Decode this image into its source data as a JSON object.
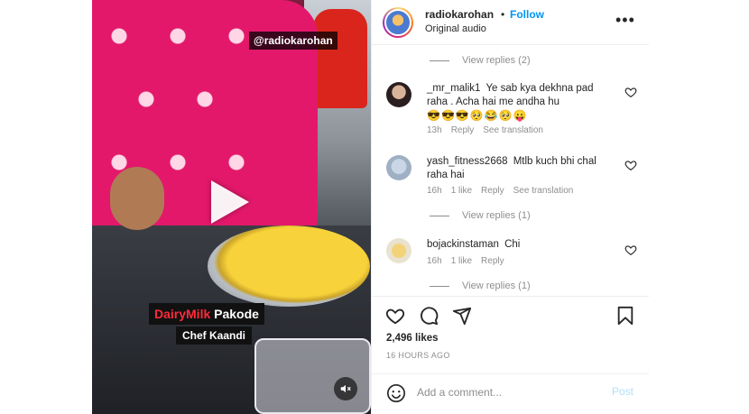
{
  "video": {
    "handle_overlay": "@radiokarohan",
    "title_red": "DairyMilk",
    "title_white": "Pakode",
    "subtitle": "Chef Kaandi"
  },
  "header": {
    "username": "radiokarohan",
    "separator": "•",
    "follow_label": "Follow",
    "audio": "Original audio",
    "more_icon": "more-horizontal-icon"
  },
  "comments": {
    "replies_top": "View replies (2)",
    "items": [
      {
        "username": "_mr_malik1",
        "text": "Ye sab kya dekhna pad raha . Acha hai me andha hu",
        "emojis": "😎😎😎🥺😂🥺😛",
        "time": "13h",
        "likes": "",
        "reply": "Reply",
        "translate": "See translation",
        "replies": ""
      },
      {
        "username": "yash_fitness2668",
        "text": "Mtlb kuch bhi chal raha hai",
        "emojis": "",
        "time": "16h",
        "likes": "1 like",
        "reply": "Reply",
        "translate": "See translation",
        "replies": "View replies (1)"
      },
      {
        "username": "bojackinstaman",
        "text": "Chi",
        "emojis": "",
        "time": "16h",
        "likes": "1 like",
        "reply": "Reply",
        "translate": "",
        "replies": "View replies (1)"
      }
    ]
  },
  "actions": {
    "like_icon": "heart-icon",
    "comment_icon": "comment-icon",
    "share_icon": "share-icon",
    "save_icon": "bookmark-icon"
  },
  "likes": "2,496 likes",
  "time_ago": "16 HOURS AGO",
  "add_comment": {
    "placeholder": "Add a comment...",
    "post_label": "Post",
    "emoji_icon": "smiley-icon"
  },
  "colors": {
    "accent": "#0095f6",
    "post_disabled": "#b2dffc",
    "secondary_text": "#8e8e8e"
  }
}
